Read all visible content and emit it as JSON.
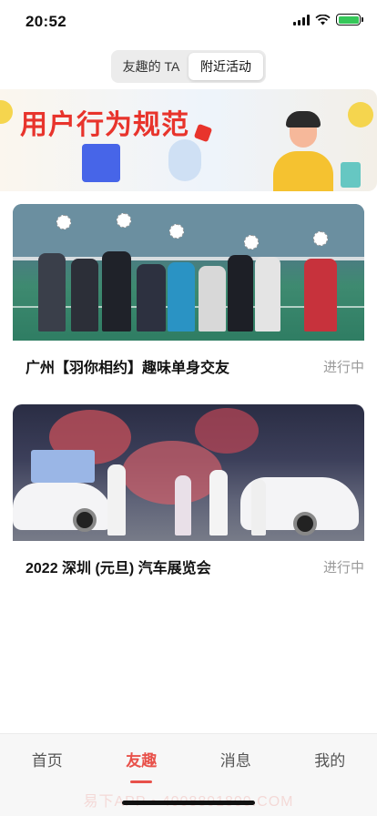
{
  "status_bar": {
    "time": "20:52"
  },
  "segment": {
    "tabs": [
      "友趣的 TA",
      "附近活动"
    ],
    "active_index": 1
  },
  "banner": {
    "title": "用户行为规范"
  },
  "activities": [
    {
      "title": "广州【羽你相约】趣味单身交友",
      "status": "进行中",
      "image": "badminton-group-photo"
    },
    {
      "title": "2022 深圳 (元旦) 汽车展览会",
      "status": "进行中",
      "image": "auto-show-photo"
    }
  ],
  "tabbar": {
    "items": [
      "首页",
      "友趣",
      "消息",
      "我的"
    ],
    "active_index": 1,
    "watermark": "易下APP • 4008891800.COM"
  },
  "colors": {
    "accent": "#e8514a",
    "banner_title": "#e8342c",
    "status_gray": "#9a9a9a"
  }
}
